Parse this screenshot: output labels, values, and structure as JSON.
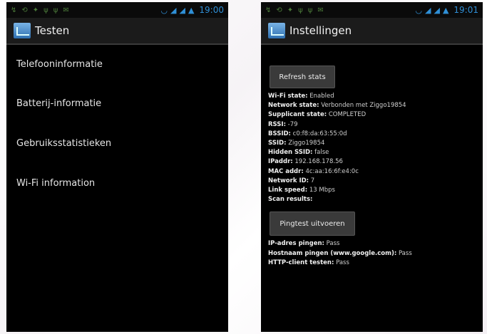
{
  "left": {
    "status": {
      "time": "19:00"
    },
    "title": "Testen",
    "items": [
      {
        "label": "Telefooninformatie"
      },
      {
        "label": "Batterij-informatie"
      },
      {
        "label": "Gebruiksstatistieken"
      },
      {
        "label": "Wi-Fi information"
      }
    ]
  },
  "right": {
    "status": {
      "time": "19:01"
    },
    "title": "Instellingen",
    "refresh_label": "Refresh stats",
    "info": [
      {
        "label": "Wi-Fi state:",
        "value": "Enabled"
      },
      {
        "label": "Network state:",
        "value": "Verbonden met Ziggo19854"
      },
      {
        "label": "Supplicant state:",
        "value": "COMPLETED"
      },
      {
        "label": "RSSI:",
        "value": "-79"
      },
      {
        "label": "BSSID:",
        "value": "c0:f8:da:63:55:0d"
      },
      {
        "label": "SSID:",
        "value": "Ziggo19854"
      },
      {
        "label": "Hidden SSID:",
        "value": "false"
      },
      {
        "label": "IPaddr:",
        "value": "192.168.178.56"
      },
      {
        "label": "MAC addr:",
        "value": "4c:aa:16:6f:e4:0c"
      },
      {
        "label": "Network ID:",
        "value": "7"
      },
      {
        "label": "Link speed:",
        "value": "13 Mbps"
      },
      {
        "label": "Scan results:",
        "value": ""
      }
    ],
    "ping_label": "Pingtest uitvoeren",
    "ping": [
      {
        "label": "IP-adres pingen:",
        "value": "Pass"
      },
      {
        "label": "Hostnaam pingen (www.google.com):",
        "value": "Pass"
      },
      {
        "label": "HTTP-client testen:",
        "value": "Pass"
      }
    ]
  },
  "colors": {
    "status_accent": "#2f8fd6",
    "background": "#000000",
    "action_bar": "#1b1b1b"
  },
  "icons": [
    "notification-icons",
    "wifi-icon",
    "signal-icon",
    "battery-icon",
    "app-settings-icon"
  ]
}
